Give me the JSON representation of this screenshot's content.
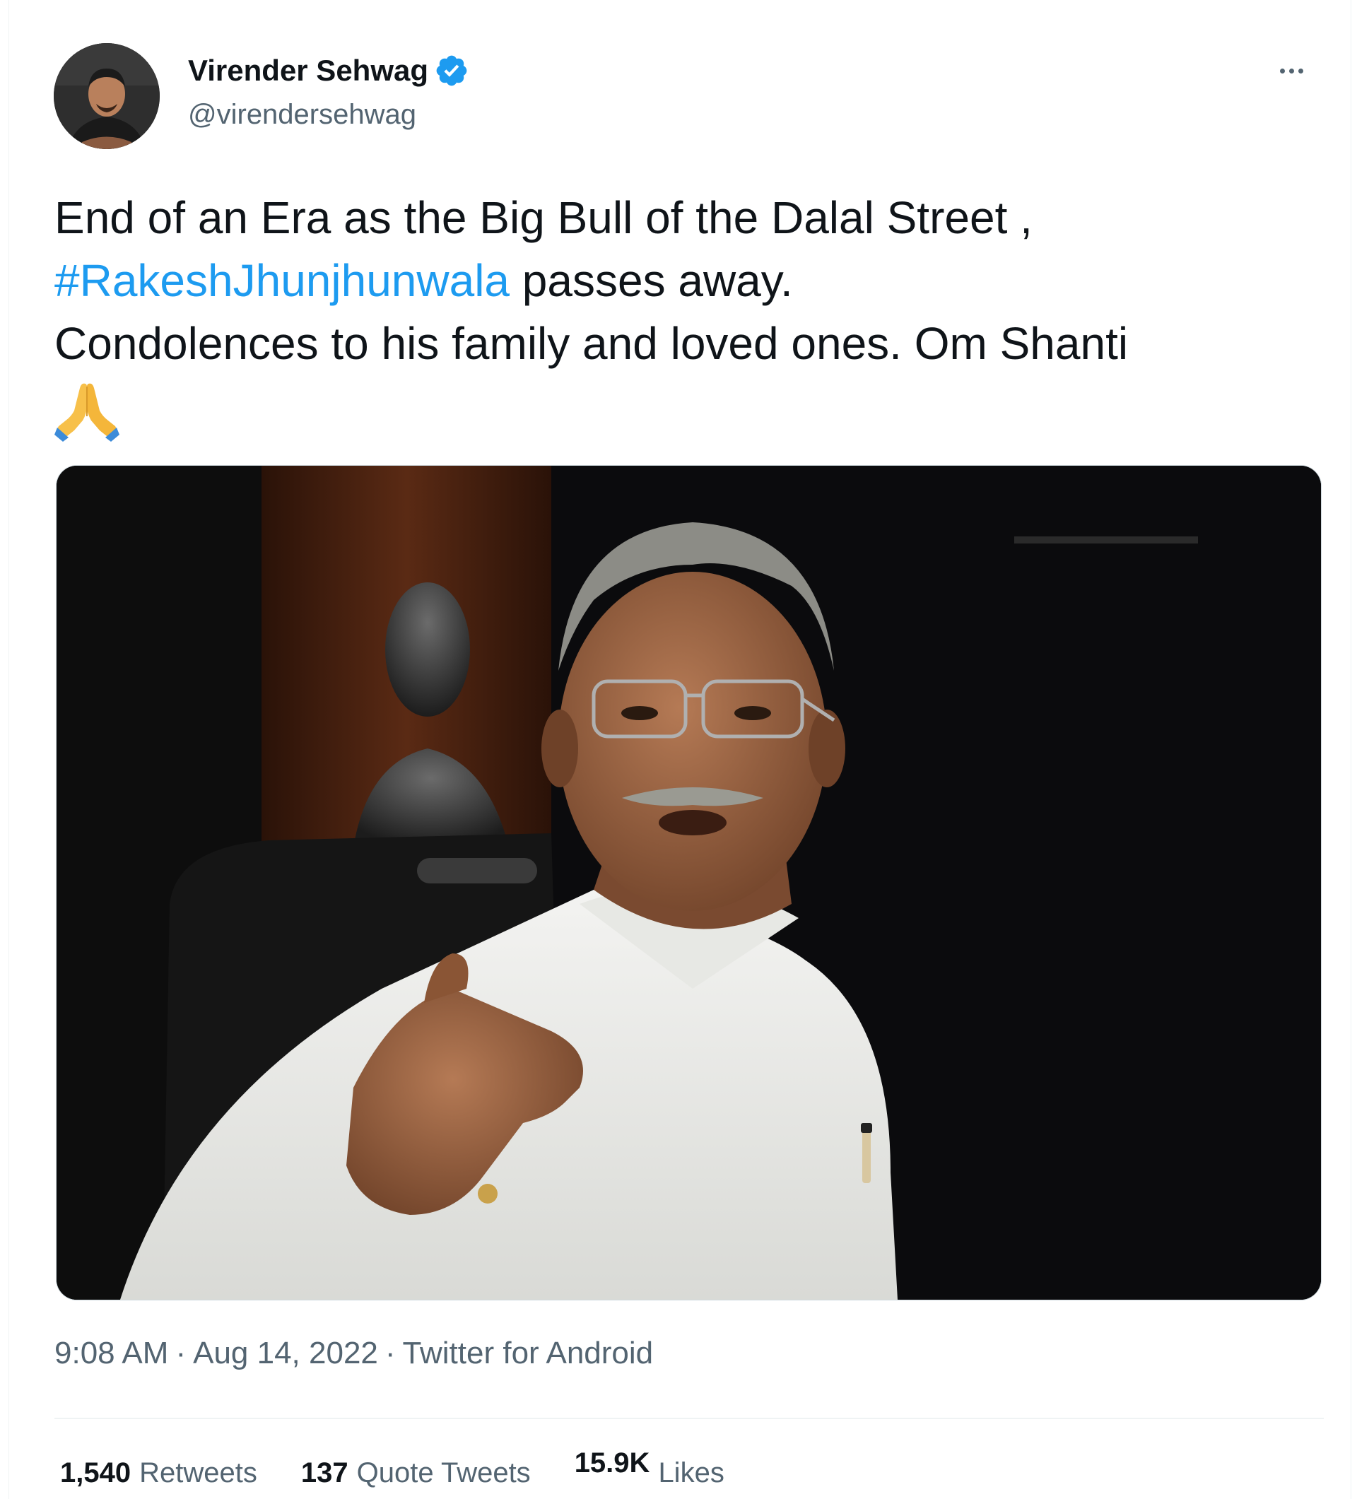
{
  "author": {
    "name": "Virender Sehwag",
    "handle": "@virendersehwag"
  },
  "tweet": {
    "line1": "End of an Era as the Big Bull of the Dalal Street ,",
    "hashtag": "#RakeshJhunjhunwala",
    "line2_rest": " passes away.",
    "line3": "Condolences to his family and loved ones. Om Shanti",
    "emoji": "folded-hands"
  },
  "meta": {
    "time": "9:08 AM",
    "sep1": "·",
    "date": "Aug 14, 2022",
    "sep2": "·",
    "source": "Twitter for Android"
  },
  "stats": {
    "retweets_count": "1,540",
    "retweets_label": "Retweets",
    "quotes_count": "137",
    "quotes_label": "Quote Tweets",
    "likes_count": "15.9K",
    "likes_label": "Likes"
  },
  "colors": {
    "link": "#1d9bf0",
    "secondary_text": "#536471",
    "primary_text": "#0f1419",
    "verified": "#1d9bf0"
  },
  "icons": [
    "verified-badge-icon",
    "more-options-icon",
    "folded-hands-emoji"
  ]
}
